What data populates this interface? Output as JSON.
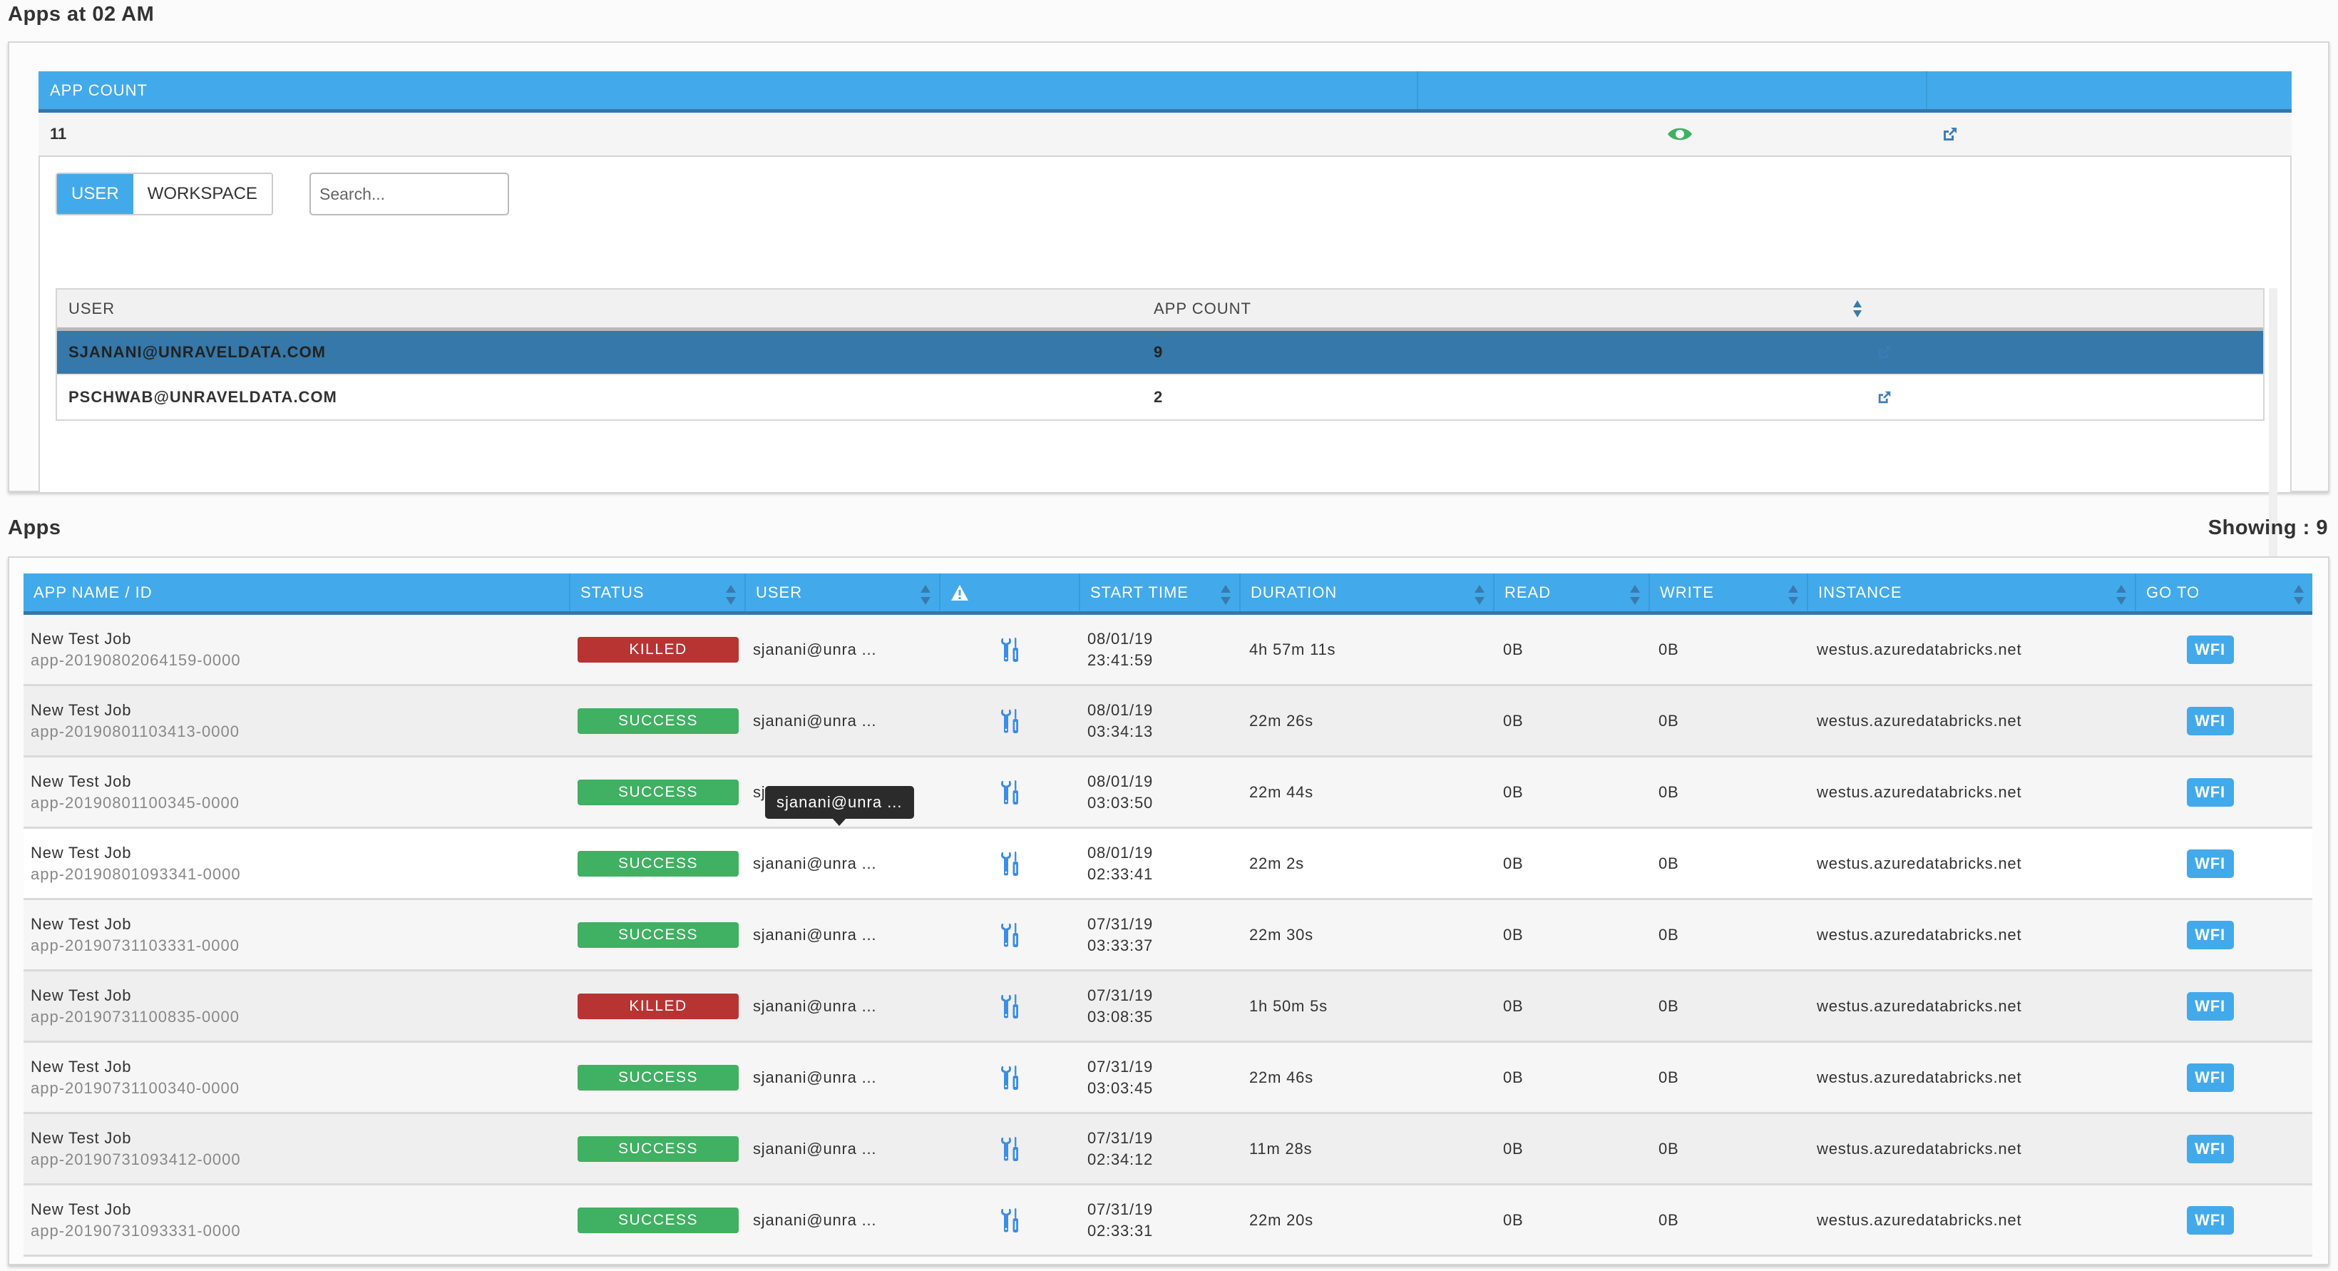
{
  "summary": {
    "title": "Apps at 02 AM",
    "header": {
      "col1": "APP COUNT",
      "col2": "",
      "col3": ""
    },
    "row": {
      "app_count": "11",
      "view_icon": "eye-icon",
      "open_icon": "external-link-icon"
    },
    "tabs": [
      {
        "label": "USER",
        "active": true
      },
      {
        "label": "WORKSPACE",
        "active": false
      }
    ],
    "search": {
      "placeholder": "Search...",
      "value": ""
    },
    "user_table": {
      "headers": {
        "user": "USER",
        "app_count": "APP COUNT"
      },
      "rows": [
        {
          "user": "SJANANI@UNRAVELDATA.COM",
          "app_count": "9",
          "selected": true
        },
        {
          "user": "PSCHWAB@UNRAVELDATA.COM",
          "app_count": "2",
          "selected": false
        }
      ]
    }
  },
  "apps": {
    "title": "Apps",
    "showing": "Showing : 9",
    "headers": {
      "name": "APP NAME / ID",
      "status": "STATUS",
      "user": "USER",
      "warn_icon": "warning-icon",
      "start": "START TIME",
      "duration": "DURATION",
      "read": "READ",
      "write": "WRITE",
      "instance": "INSTANCE",
      "goto": "GO TO"
    },
    "colors": {
      "killed": "#b83432",
      "success": "#40b062",
      "header": "#42aaeb",
      "accent_dark": "#3477aa"
    },
    "rows": [
      {
        "name": "New Test Job",
        "id": "app-20190802064159-0000",
        "status": "KILLED",
        "user": "sjanani@unra ...",
        "date": "08/01/19",
        "time": "23:41:59",
        "duration": "4h 57m 11s",
        "read": "0B",
        "write": "0B",
        "instance": "westus.azuredatabricks.net",
        "goto": "WFI"
      },
      {
        "name": "New Test Job",
        "id": "app-20190801103413-0000",
        "status": "SUCCESS",
        "user": "sjanani@unra ...",
        "date": "08/01/19",
        "time": "03:34:13",
        "duration": "22m 26s",
        "read": "0B",
        "write": "0B",
        "instance": "westus.azuredatabricks.net",
        "goto": "WFI"
      },
      {
        "name": "New Test Job",
        "id": "app-20190801100345-0000",
        "status": "SUCCESS",
        "user": "sjanani@unra ...",
        "date": "08/01/19",
        "time": "03:03:50",
        "duration": "22m 44s",
        "read": "0B",
        "write": "0B",
        "instance": "westus.azuredatabricks.net",
        "goto": "WFI"
      },
      {
        "name": "New Test Job",
        "id": "app-20190801093341-0000",
        "status": "SUCCESS",
        "user": "sjanani@unra ...",
        "date": "08/01/19",
        "time": "02:33:41",
        "duration": "22m 2s",
        "read": "0B",
        "write": "0B",
        "instance": "westus.azuredatabricks.net",
        "goto": "WFI"
      },
      {
        "name": "New Test Job",
        "id": "app-20190731103331-0000",
        "status": "SUCCESS",
        "user": "sjanani@unra ...",
        "date": "07/31/19",
        "time": "03:33:37",
        "duration": "22m 30s",
        "read": "0B",
        "write": "0B",
        "instance": "westus.azuredatabricks.net",
        "goto": "WFI"
      },
      {
        "name": "New Test Job",
        "id": "app-20190731100835-0000",
        "status": "KILLED",
        "user": "sjanani@unra ...",
        "date": "07/31/19",
        "time": "03:08:35",
        "duration": "1h 50m 5s",
        "read": "0B",
        "write": "0B",
        "instance": "westus.azuredatabricks.net",
        "goto": "WFI"
      },
      {
        "name": "New Test Job",
        "id": "app-20190731100340-0000",
        "status": "SUCCESS",
        "user": "sjanani@unra ...",
        "date": "07/31/19",
        "time": "03:03:45",
        "duration": "22m 46s",
        "read": "0B",
        "write": "0B",
        "instance": "westus.azuredatabricks.net",
        "goto": "WFI"
      },
      {
        "name": "New Test Job",
        "id": "app-20190731093412-0000",
        "status": "SUCCESS",
        "user": "sjanani@unra ...",
        "date": "07/31/19",
        "time": "02:34:12",
        "duration": "11m 28s",
        "read": "0B",
        "write": "0B",
        "instance": "westus.azuredatabricks.net",
        "goto": "WFI"
      },
      {
        "name": "New Test Job",
        "id": "app-20190731093331-0000",
        "status": "SUCCESS",
        "user": "sjanani@unra ...",
        "date": "07/31/19",
        "time": "02:33:31",
        "duration": "22m 20s",
        "read": "0B",
        "write": "0B",
        "instance": "westus.azuredatabricks.net",
        "goto": "WFI"
      }
    ],
    "tooltip": "sjanani@unra ..."
  }
}
